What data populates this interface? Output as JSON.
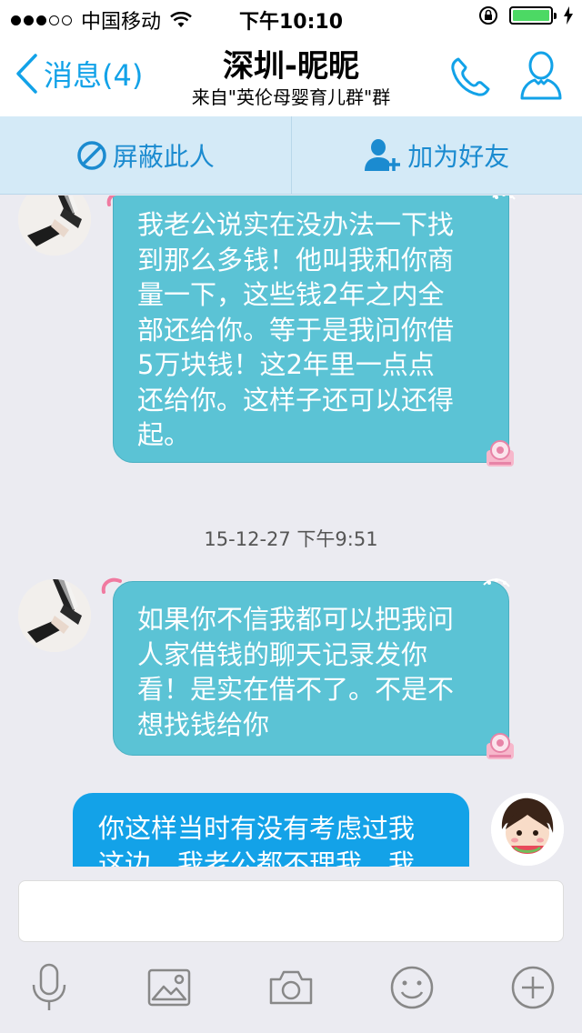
{
  "status_bar": {
    "carrier": "中国移动",
    "time": "下午10:10"
  },
  "nav": {
    "back_label": "消息(4)",
    "title": "深圳-昵昵",
    "subtitle": "来自\"英伦母婴育儿群\"群"
  },
  "actions": {
    "block_label": "屏蔽此人",
    "add_friend_label": "加为好友"
  },
  "messages": [
    {
      "direction": "incoming",
      "text": "我老公说实在没办法一下找\n到那么多钱！他叫我和你商\n量一下，这些钱2年之内全\n部还给你。等于是我问你借\n5万块钱！这2年里一点点\n还给你。这样子还可以还得\n起。"
    },
    {
      "timestamp": "15-12-27 下午9:51"
    },
    {
      "direction": "incoming",
      "text": "如果你不信我都可以把我问\n人家借钱的聊天记录发你\n看！是实在借不了。不是不\n想找钱给你"
    },
    {
      "direction": "outgoing",
      "text": "你这样当时有没有考虑过我\n这边，我老公都不理我，我"
    }
  ],
  "input": {
    "value": ""
  },
  "colors": {
    "accent": "#12a2e8",
    "incoming_bubble": "#5bc3d5",
    "outgoing_bubble": "#13a2e8",
    "action_bar": "#d4eaf7"
  },
  "toolbar_icons": [
    "microphone-icon",
    "image-icon",
    "camera-icon",
    "emoji-icon",
    "plus-icon"
  ]
}
